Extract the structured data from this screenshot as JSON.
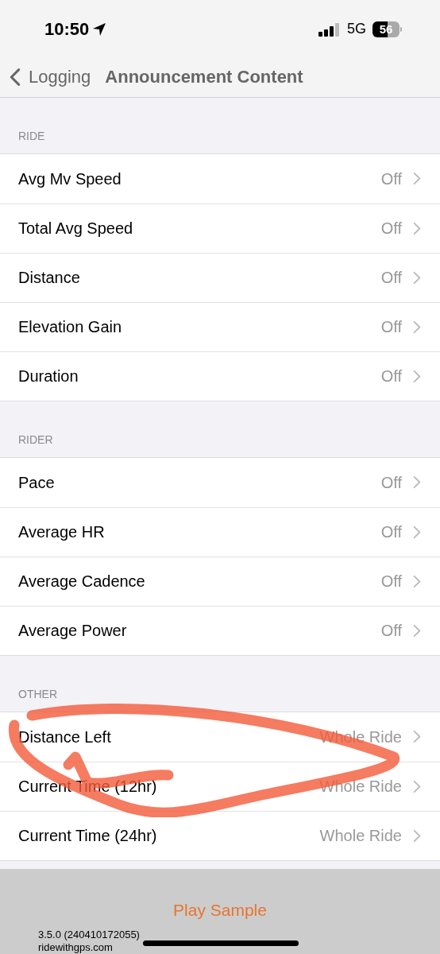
{
  "status_bar": {
    "time": "10:50",
    "network": "5G",
    "battery": "56"
  },
  "nav": {
    "back": "Logging",
    "title": "Announcement Content"
  },
  "sections": [
    {
      "header": "RIDE",
      "rows": [
        {
          "label": "Avg Mv Speed",
          "value": "Off"
        },
        {
          "label": "Total Avg Speed",
          "value": "Off"
        },
        {
          "label": "Distance",
          "value": "Off"
        },
        {
          "label": "Elevation Gain",
          "value": "Off"
        },
        {
          "label": "Duration",
          "value": "Off"
        }
      ]
    },
    {
      "header": "RIDER",
      "rows": [
        {
          "label": "Pace",
          "value": "Off"
        },
        {
          "label": "Average HR",
          "value": "Off"
        },
        {
          "label": "Average Cadence",
          "value": "Off"
        },
        {
          "label": "Average Power",
          "value": "Off"
        }
      ]
    },
    {
      "header": "OTHER",
      "rows": [
        {
          "label": "Distance Left",
          "value": "Whole Ride"
        },
        {
          "label": "Current Time (12hr)",
          "value": "Whole Ride"
        },
        {
          "label": "Current Time (24hr)",
          "value": "Whole Ride"
        }
      ]
    }
  ],
  "footer": {
    "button": "Play Sample",
    "version": "3.5.0 (240410172055)",
    "site": "ridewithgps.com"
  }
}
